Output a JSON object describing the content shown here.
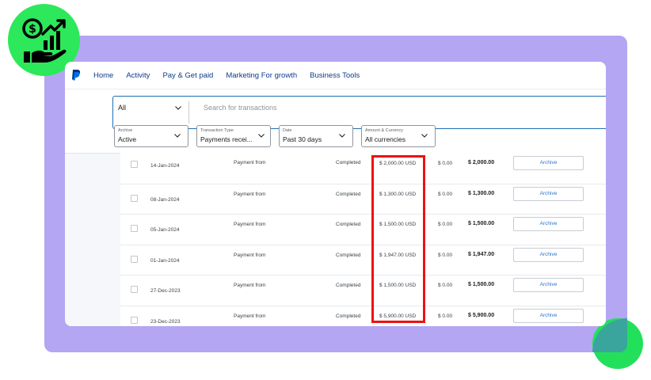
{
  "nav": {
    "items": [
      "Home",
      "Activity",
      "Pay & Get paid",
      "Marketing For growth",
      "Business Tools"
    ]
  },
  "filters": {
    "all_label": "All",
    "search_placeholder": "Search for transactions",
    "archive": {
      "label": "Archive",
      "value": "Active"
    },
    "type": {
      "label": "Transaction Type",
      "value": "Payments recei..."
    },
    "date": {
      "label": "Date",
      "value": "Past 30 days"
    },
    "currency": {
      "label": "Amount & Currency",
      "value": "All currencies"
    }
  },
  "rows": [
    {
      "date": "14-Jan-2024",
      "desc": "Payment from",
      "status": "Completed",
      "gross": "$ 2,000.00 USD",
      "fee": "$ 0.00",
      "net": "$ 2,000.00",
      "action": "Archive"
    },
    {
      "date": "08-Jan-2024",
      "desc": "Payment from",
      "status": "Completed",
      "gross": "$ 1,300.00 USD",
      "fee": "$ 0.00",
      "net": "$ 1,300.00",
      "action": "Archive"
    },
    {
      "date": "05-Jan-2024",
      "desc": "Payment from",
      "status": "Completed",
      "gross": "$ 1,500.00 USD",
      "fee": "$ 0.00",
      "net": "$ 1,500.00",
      "action": "Archive"
    },
    {
      "date": "01-Jan-2024",
      "desc": "Payment from",
      "status": "Completed",
      "gross": "$ 1,947.00 USD",
      "fee": "$ 0.00",
      "net": "$ 1,947.00",
      "action": "Archive"
    },
    {
      "date": "27-Dec-2023",
      "desc": "Payment from",
      "status": "Completed",
      "gross": "$ 1,500.00 USD",
      "fee": "$ 0.00",
      "net": "$ 1,500.00",
      "action": "Archive"
    },
    {
      "date": "23-Dec-2023",
      "desc": "Payment from",
      "status": "Completed",
      "gross": "$ 5,900.00 USD",
      "fee": "$ 0.00",
      "net": "$ 5,900.00",
      "action": "Archive"
    }
  ],
  "colors": {
    "frame": "#b4a6f2",
    "badge": "#2ce85a",
    "highlight": "#ee1111",
    "nav_text": "#0c3c8c",
    "link": "#2b73c9"
  },
  "icons": {
    "badge": "money-hand-growth-icon",
    "logo": "paypal-logo-icon"
  }
}
